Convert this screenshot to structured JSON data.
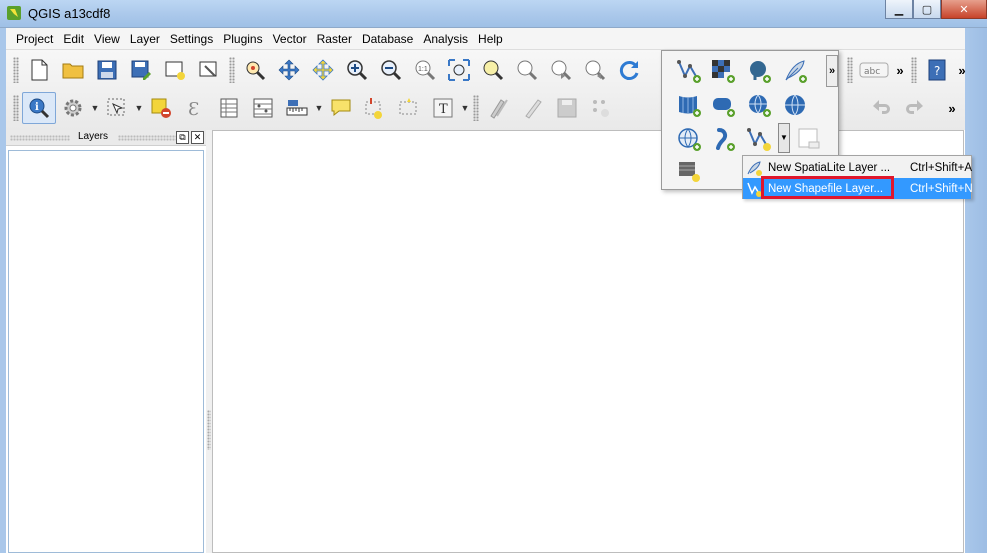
{
  "window": {
    "title": "QGIS a13cdf8",
    "min": "▁",
    "max": "▢",
    "close": "✕"
  },
  "menu": [
    "Project",
    "Edit",
    "View",
    "Layer",
    "Settings",
    "Plugins",
    "Vector",
    "Raster",
    "Database",
    "Analysis",
    "Help"
  ],
  "toolbar": {
    "more": "»",
    "abc_label": "abc",
    "dropdown_arrow": "▼",
    "text_tool": "T",
    "epsilon": "Ɛ"
  },
  "layers_panel": {
    "title": "Layers",
    "float": "⧉",
    "close": "✕"
  },
  "new_layer_menu": {
    "items": [
      {
        "label": "New SpatiaLite Layer ...",
        "shortcut": "Ctrl+Shift+A"
      },
      {
        "label": "New Shapefile Layer...",
        "shortcut": "Ctrl+Shift+N"
      }
    ]
  },
  "colors": {
    "accent": "#3399ff",
    "highlight_box": "#e0162b",
    "qgis_green": "#5aa02c"
  }
}
